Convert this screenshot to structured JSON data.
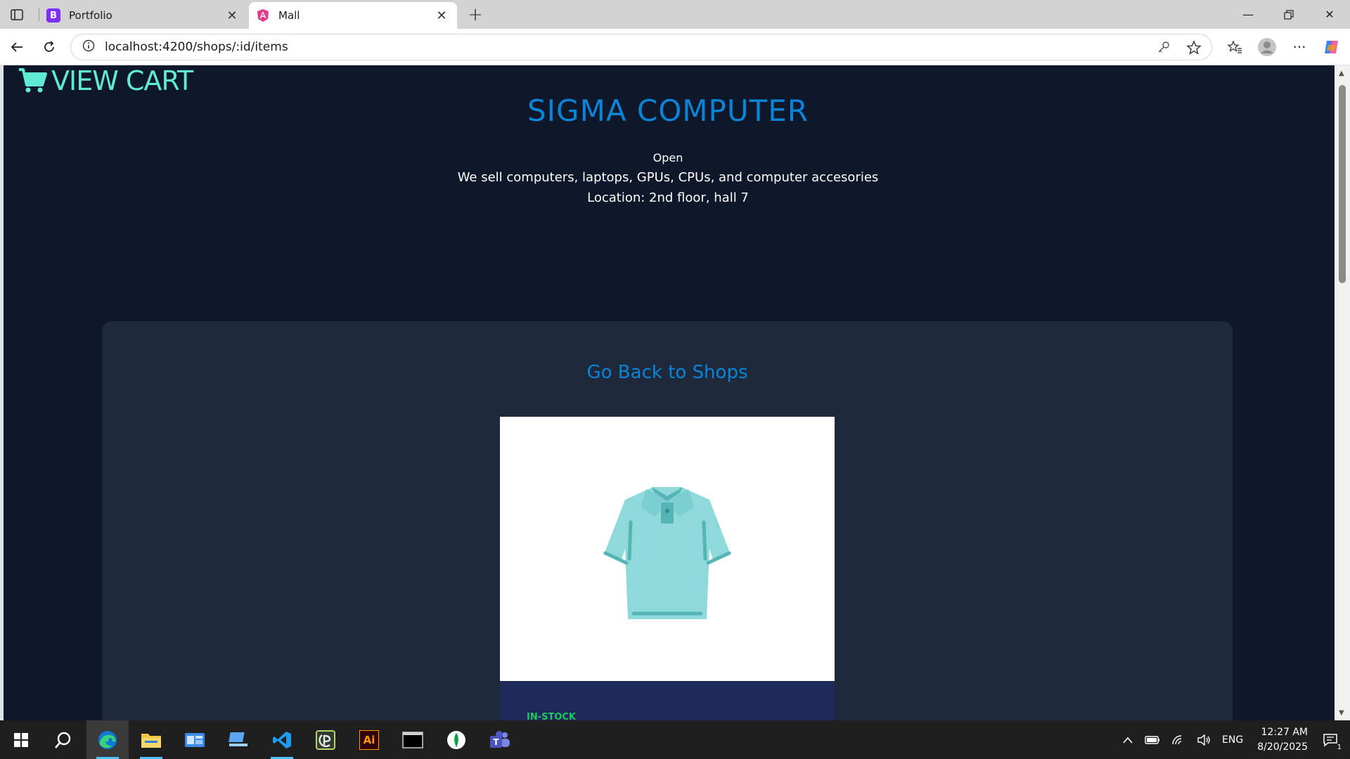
{
  "browser": {
    "tabs": [
      {
        "title": "Portfolio",
        "favicon": "bootstrap-icon",
        "favicon_letter": "B",
        "active": false
      },
      {
        "title": "Mall",
        "favicon": "angular-icon",
        "active": true
      }
    ],
    "url": "localhost:4200/shops/:id/items"
  },
  "page": {
    "view_cart_label": "VIEW CART",
    "shop": {
      "name": "SIGMA COMPUTER",
      "status": "Open",
      "description": "We sell computers, laptops, GPUs, CPUs, and computer accesories",
      "location": "Location: 2nd floor, hall 7"
    },
    "go_back_label": "Go Back to Shops",
    "items": [
      {
        "image": "polo-shirt-icon",
        "stock_status": "IN-STOCK"
      }
    ],
    "colors": {
      "background": "#0f172a",
      "panel": "#1e293b",
      "accent_blue": "#0b84d6",
      "cart_teal": "#5eead4",
      "stock_green": "#22c55e"
    }
  },
  "taskbar": {
    "apps": [
      "windows-start-icon",
      "search-icon",
      "edge-icon",
      "file-explorer-icon",
      "control-panel-icon",
      "remote-desktop-icon",
      "vscode-icon",
      "cross-platform-icon",
      "illustrator-icon",
      "terminal-icon",
      "mongodb-icon",
      "teams-icon"
    ],
    "illustrator_label": "Ai",
    "language": "ENG",
    "time": "12:27 AM",
    "date": "8/20/2025",
    "notification_count": "1"
  }
}
